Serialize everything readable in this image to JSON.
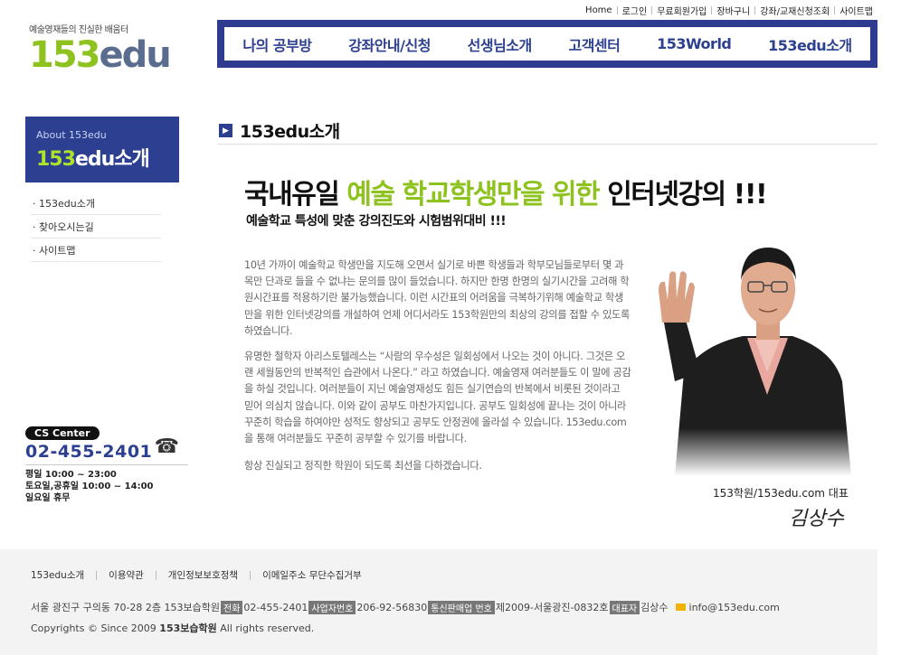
{
  "top_links": [
    "Home",
    "로그인",
    "무료회원가입",
    "장바구니",
    "강좌/교재신청조회",
    "사이트맵"
  ],
  "logo": {
    "tagline": "예술영재들의 진실한 배움터",
    "num": "153",
    "text": "edu"
  },
  "nav": [
    "나의 공부방",
    "강좌안내/신청",
    "선생님소개",
    "고객센터",
    "153World",
    "153edu소개"
  ],
  "sidebar": {
    "sub": "About 153edu",
    "title_num": "153",
    "title_rest": "edu소개",
    "items": [
      "· 153edu소개",
      "· 찾아오시는길",
      "· 사이트맵"
    ]
  },
  "cs": {
    "label": "CS Center",
    "phone": "02-455-2401",
    "hours": [
      "평일 10:00 ~ 23:00",
      "토요일,공휴일 10:00 ~ 14:00",
      "일요일 휴무"
    ]
  },
  "section_title": "153edu소개",
  "headline": {
    "part1": "국내유일 ",
    "highlight": "예술 학교학생만을 위한",
    "part2": " 인터넷강의 !!!"
  },
  "subhead": "예술학교 특성에 맞춘 강의진도와 시험범위대비 !!!",
  "body": [
    "10년 가까이 예술학교 학생만을 지도해 오면서 실기로 바쁜 학생들과 학부모님들로부터 몇 과목만 단과로 들을 수 없냐는 문의를 많이 들었습니다. 하지만 한명 한명의 실기시간을 고려해 학원시간표를 적용하기란 불가능했습니다. 이런 시간표의 어려움을 극복하기위해 예술학교 학생만을 위한 인터넷강의를 개설하여 언제 어디서라도 153학원만의 최상의 강의를 접할 수 있도록 하였습니다.",
    "유명한 철학자 아리스토텔레스는 “사람의 우수성은 일회성에서 나오는 것이 아니다. 그것은 오랜 세월동안의 반복적인 습관에서 나온다.” 라고 하였습니다. 예술영재 여러분들도 이 말에 공감을 하실 것입니다. 여러분들이 지닌 예술영재성도 힘든 실기연습의 반복에서 비롯된 것이라고 믿어 의심치 않습니다. 이와 같이 공부도 마찬가지입니다. 공부도 일회성에 끝나는 것이 아니라 꾸준히 학습을 하여야만 성적도 향상되고 공부도 안정권에 올라설 수 있습니다. 153edu.com을 통해 여러분들도 꾸준히 공부할 수 있기를 바랍니다.",
    "항상 진실되고 정직한 학원이 되도록 최선을 다하겠습니다."
  ],
  "signature": {
    "title": "153학원/153edu.com 대표",
    "name": "김상수"
  },
  "footer": {
    "links": [
      "153edu소개",
      "이용약관",
      "개인정보보호정책",
      "이메일주소 무단수집거부"
    ],
    "address": "서울 광진구 구의동 70-28 2층 153보습학원",
    "tel_label": "전화",
    "tel": "02-455-2401",
    "biz_label": "사업자번호",
    "biz": "206-92-56830",
    "mail_order_label": "통신판매업 번호",
    "mail_order": "제2009-서울광진-0832호",
    "rep_label": "대표자",
    "rep": "김상수",
    "email": "info@153edu.com",
    "copy_pre": "Copyrights © Since 2009 ",
    "copy_bold": "153보습학원",
    "copy_post": " All rights reserved."
  }
}
